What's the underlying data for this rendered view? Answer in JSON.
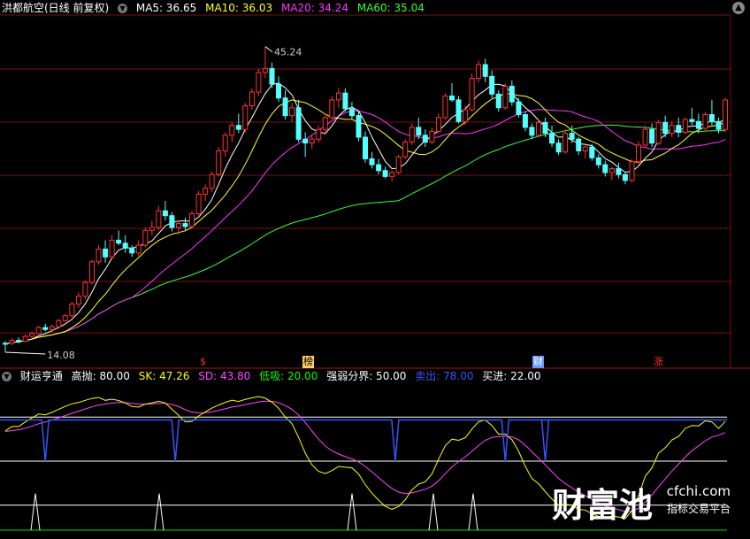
{
  "main_header": {
    "title": "洪都航空(日线 前复权)",
    "ma5_label": "MA5: 36.65",
    "ma10_label": "MA10: 36.03",
    "ma20_label": "MA20: 34.24",
    "ma60_label": "MA60: 35.04",
    "colors": {
      "ma5": "#ffffff",
      "ma10": "#ffff33",
      "ma20": "#ff33ff",
      "ma60": "#33ff33"
    }
  },
  "price_annotations": {
    "high": "45.24",
    "low": "14.08"
  },
  "signals": [
    "$",
    "榜",
    "财",
    "涨"
  ],
  "indicator_header": {
    "name": "财运亨通",
    "gaopao": "高抛: 80.00",
    "sk": "SK: 47.26",
    "sd": "SD: 43.80",
    "dixi": "低吸: 20.00",
    "qiangruo": "强弱分界: 50.00",
    "maichu": "卖出: 78.00",
    "maijin": "买进: 22.00",
    "colors": {
      "gaopao": "#ffffff",
      "sk": "#ffff00",
      "sd": "#ff44ff",
      "dixi": "#00ff00",
      "qiangruo": "#ffffff",
      "maichu": "#3355ff",
      "maijin": "#ffffff"
    }
  },
  "watermark": {
    "brand": "财富池",
    "url": "cfchi.com",
    "tagline": "指标交易平台"
  },
  "chart_data": {
    "type": "candlestick",
    "title": "洪都航空(日线 前复权)",
    "candles": [
      [
        15.0,
        15.2,
        14.1,
        14.9
      ],
      [
        15.0,
        15.5,
        14.8,
        15.3
      ],
      [
        15.3,
        15.6,
        15.0,
        15.2
      ],
      [
        15.2,
        15.9,
        15.1,
        15.7
      ],
      [
        15.7,
        16.2,
        15.5,
        16.0
      ],
      [
        16.0,
        16.8,
        15.9,
        16.6
      ],
      [
        16.6,
        17.0,
        16.2,
        16.4
      ],
      [
        16.4,
        16.9,
        16.1,
        16.7
      ],
      [
        16.7,
        17.5,
        16.5,
        17.3
      ],
      [
        17.3,
        18.0,
        17.1,
        17.8
      ],
      [
        17.8,
        19.2,
        17.6,
        19.0
      ],
      [
        19.0,
        20.2,
        18.6,
        19.8
      ],
      [
        19.8,
        21.4,
        19.5,
        21.2
      ],
      [
        21.2,
        23.5,
        21.0,
        23.3
      ],
      [
        23.3,
        25.0,
        23.0,
        24.6
      ],
      [
        24.6,
        25.5,
        23.2,
        23.8
      ],
      [
        23.8,
        26.0,
        23.5,
        25.5
      ],
      [
        25.5,
        26.5,
        25.0,
        25.2
      ],
      [
        25.2,
        26.0,
        24.2,
        24.7
      ],
      [
        24.7,
        25.0,
        23.8,
        24.2
      ],
      [
        24.2,
        25.5,
        23.9,
        25.0
      ],
      [
        25.0,
        26.8,
        24.8,
        26.5
      ],
      [
        26.5,
        27.5,
        26.0,
        26.8
      ],
      [
        26.8,
        29.0,
        26.5,
        28.5
      ],
      [
        28.5,
        29.5,
        27.5,
        28.0
      ],
      [
        28.0,
        28.4,
        26.4,
        26.8
      ],
      [
        26.8,
        27.5,
        26.1,
        27.2
      ],
      [
        27.2,
        27.8,
        26.5,
        26.9
      ],
      [
        26.9,
        28.5,
        26.7,
        28.2
      ],
      [
        28.2,
        30.5,
        28.0,
        30.2
      ],
      [
        30.2,
        31.2,
        29.5,
        30.8
      ],
      [
        30.8,
        32.5,
        30.4,
        32.2
      ],
      [
        32.2,
        35.0,
        32.0,
        34.6
      ],
      [
        34.6,
        36.5,
        34.0,
        36.2
      ],
      [
        36.2,
        37.5,
        35.5,
        37.2
      ],
      [
        37.2,
        38.4,
        36.4,
        36.8
      ],
      [
        36.8,
        39.5,
        36.5,
        39.2
      ],
      [
        39.2,
        41.0,
        38.8,
        40.6
      ],
      [
        40.6,
        43.0,
        40.2,
        42.6
      ],
      [
        42.6,
        45.24,
        42.0,
        43.0
      ],
      [
        43.0,
        43.6,
        41.0,
        41.4
      ],
      [
        41.4,
        42.2,
        39.6,
        40.0
      ],
      [
        40.0,
        40.8,
        37.8,
        38.2
      ],
      [
        38.2,
        39.5,
        37.5,
        39.0
      ],
      [
        39.0,
        39.8,
        35.5,
        35.8
      ],
      [
        35.8,
        36.5,
        34.0,
        35.4
      ],
      [
        35.4,
        36.2,
        34.8,
        35.8
      ],
      [
        35.8,
        37.2,
        35.4,
        36.8
      ],
      [
        36.8,
        38.4,
        36.4,
        38.0
      ],
      [
        38.0,
        40.2,
        37.8,
        39.8
      ],
      [
        39.8,
        41.0,
        39.0,
        40.5
      ],
      [
        40.5,
        41.0,
        38.6,
        38.9
      ],
      [
        38.9,
        39.6,
        37.8,
        38.2
      ],
      [
        38.2,
        38.6,
        35.6,
        36.0
      ],
      [
        36.0,
        36.6,
        33.4,
        33.8
      ],
      [
        33.8,
        34.5,
        32.8,
        33.2
      ],
      [
        33.2,
        33.8,
        32.2,
        32.6
      ],
      [
        32.6,
        33.0,
        31.8,
        32.0
      ],
      [
        32.0,
        32.6,
        31.5,
        32.4
      ],
      [
        32.4,
        34.2,
        32.2,
        34.0
      ],
      [
        34.0,
        35.8,
        33.8,
        35.5
      ],
      [
        35.5,
        37.4,
        35.2,
        37.0
      ],
      [
        37.0,
        38.0,
        35.8,
        36.2
      ],
      [
        36.2,
        36.8,
        35.0,
        35.5
      ],
      [
        35.5,
        37.0,
        35.3,
        36.6
      ],
      [
        36.6,
        38.4,
        36.4,
        38.0
      ],
      [
        38.0,
        40.5,
        37.8,
        40.2
      ],
      [
        40.2,
        41.5,
        39.6,
        39.8
      ],
      [
        39.8,
        40.2,
        37.4,
        37.6
      ],
      [
        37.6,
        39.2,
        37.3,
        38.8
      ],
      [
        38.8,
        42.5,
        38.6,
        42.0
      ],
      [
        42.0,
        43.8,
        41.6,
        43.4
      ],
      [
        43.4,
        44.0,
        41.6,
        42.2
      ],
      [
        42.2,
        42.8,
        40.0,
        40.4
      ],
      [
        40.4,
        40.8,
        38.6,
        39.0
      ],
      [
        39.0,
        41.5,
        38.8,
        41.2
      ],
      [
        41.2,
        41.8,
        39.2,
        39.6
      ],
      [
        39.6,
        40.0,
        38.0,
        38.3
      ],
      [
        38.3,
        38.6,
        36.6,
        37.0
      ],
      [
        37.0,
        37.4,
        35.8,
        36.2
      ],
      [
        36.2,
        37.8,
        36.0,
        37.5
      ],
      [
        37.5,
        38.0,
        36.0,
        36.4
      ],
      [
        36.4,
        37.2,
        35.0,
        35.4
      ],
      [
        35.4,
        35.8,
        34.2,
        34.5
      ],
      [
        34.5,
        36.8,
        34.3,
        36.4
      ],
      [
        36.4,
        37.2,
        35.4,
        35.8
      ],
      [
        35.8,
        36.0,
        34.2,
        34.6
      ],
      [
        34.6,
        35.4,
        33.8,
        35.0
      ],
      [
        35.0,
        35.3,
        33.6,
        33.9
      ],
      [
        33.9,
        34.3,
        32.8,
        33.2
      ],
      [
        33.2,
        33.6,
        32.0,
        32.4
      ],
      [
        32.4,
        33.0,
        31.6,
        32.8
      ],
      [
        32.8,
        33.4,
        31.8,
        32.2
      ],
      [
        32.2,
        32.5,
        31.2,
        31.6
      ],
      [
        31.6,
        33.8,
        31.4,
        33.5
      ],
      [
        33.5,
        35.6,
        33.2,
        35.2
      ],
      [
        35.2,
        37.2,
        35.0,
        36.8
      ],
      [
        36.8,
        37.4,
        35.0,
        35.4
      ],
      [
        35.4,
        37.8,
        35.2,
        37.5
      ],
      [
        37.5,
        38.2,
        36.0,
        36.4
      ],
      [
        36.4,
        37.6,
        36.0,
        37.2
      ],
      [
        37.2,
        38.0,
        36.0,
        36.5
      ],
      [
        36.5,
        38.0,
        36.3,
        37.8
      ],
      [
        37.8,
        39.0,
        37.2,
        37.6
      ],
      [
        37.6,
        38.4,
        36.4,
        36.9
      ],
      [
        36.9,
        38.6,
        36.6,
        38.3
      ],
      [
        38.3,
        39.8,
        37.2,
        37.6
      ],
      [
        37.6,
        38.0,
        36.4,
        36.8
      ],
      [
        36.8,
        40.0,
        36.5,
        39.8
      ]
    ],
    "ma": {
      "MA5": 36.65,
      "MA10": 36.03,
      "MA20": 34.24,
      "MA60": 35.04
    },
    "annotations": {
      "high": 45.24,
      "low": 14.08
    },
    "ylim": [
      13,
      48
    ],
    "indicator": {
      "name": "财运亨通",
      "levels": {
        "高抛": 80.0,
        "强弱分界": 50.0,
        "低吸": 20.0,
        "卖出": 78.0,
        "买进": 22.0
      },
      "last": {
        "SK": 47.26,
        "SD": 43.8
      },
      "ylim": [
        0,
        100
      ]
    }
  }
}
